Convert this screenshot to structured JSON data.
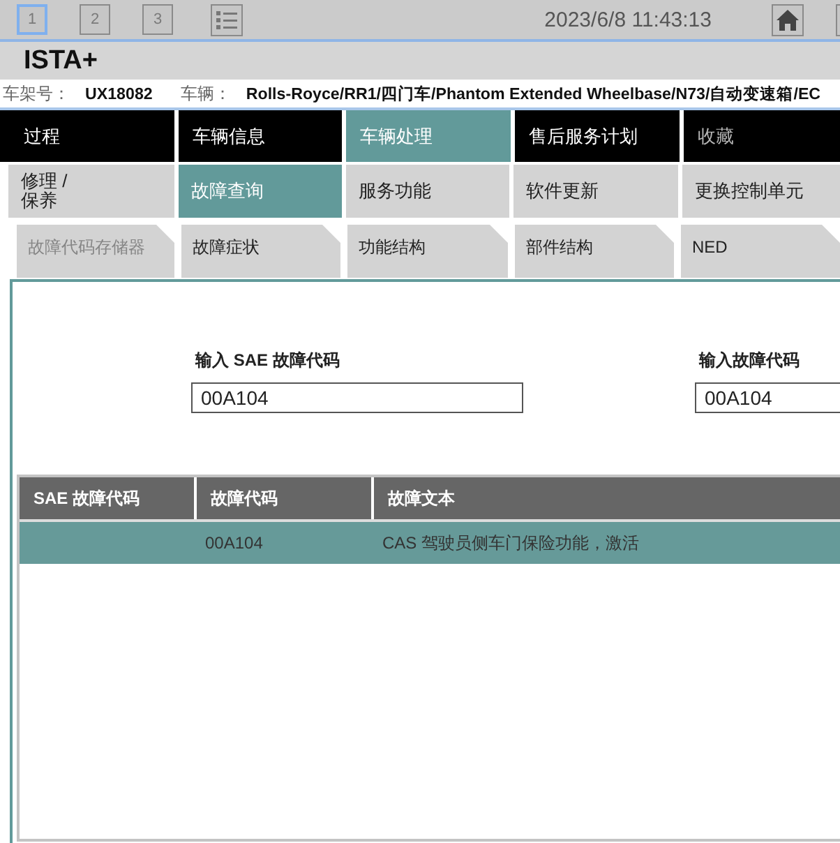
{
  "top_bar": {
    "pages": [
      {
        "label": "1",
        "selected": true
      },
      {
        "label": "2",
        "selected": false
      },
      {
        "label": "3",
        "selected": false
      }
    ],
    "datetime": "2023/6/8 11:43:13"
  },
  "app_title": "ISTA+",
  "vehicle_info": [
    {
      "label": "车架号：",
      "value": "UX18082"
    },
    {
      "label": "车辆：",
      "value": "Rolls-Royce/RR1/四门车/Phantom Extended Wheelbase/N73/自动变速箱/EC"
    }
  ],
  "main_tabs": [
    {
      "label": "过程",
      "selected": false,
      "disabled": false
    },
    {
      "label": "车辆信息",
      "selected": false,
      "disabled": false
    },
    {
      "label": "车辆处理",
      "selected": true,
      "disabled": false
    },
    {
      "label": "售后服务计划",
      "selected": false,
      "disabled": false
    },
    {
      "label": "收藏",
      "selected": false,
      "disabled": true
    }
  ],
  "sub_tabs": [
    {
      "label": "修理 /\n保养",
      "selected": false
    },
    {
      "label": "故障查询",
      "selected": true
    },
    {
      "label": "服务功能",
      "selected": false
    },
    {
      "label": "软件更新",
      "selected": false
    },
    {
      "label": "更换控制单元",
      "selected": false
    }
  ],
  "function_tabs": [
    {
      "label": "故障代码存储器",
      "selected": false,
      "disabled": true
    },
    {
      "label": "故障症状",
      "selected": false,
      "disabled": false
    },
    {
      "label": "功能结构",
      "selected": false,
      "disabled": false
    },
    {
      "label": "部件结构",
      "selected": false,
      "disabled": false
    },
    {
      "label": "NED",
      "selected": false,
      "disabled": false
    }
  ],
  "fields": [
    {
      "label": "输入 SAE 故障代码",
      "value": "00A104"
    },
    {
      "label": "输入故障代码",
      "value": "00A104"
    }
  ],
  "table": {
    "columns": [
      "SAE 故障代码",
      "故障代码",
      "故障文本"
    ],
    "rows": [
      {
        "fault_code": "00A104",
        "fault_text": "CAS 驾驶员侧车门保险功能，激活",
        "selected": true
      }
    ]
  }
}
